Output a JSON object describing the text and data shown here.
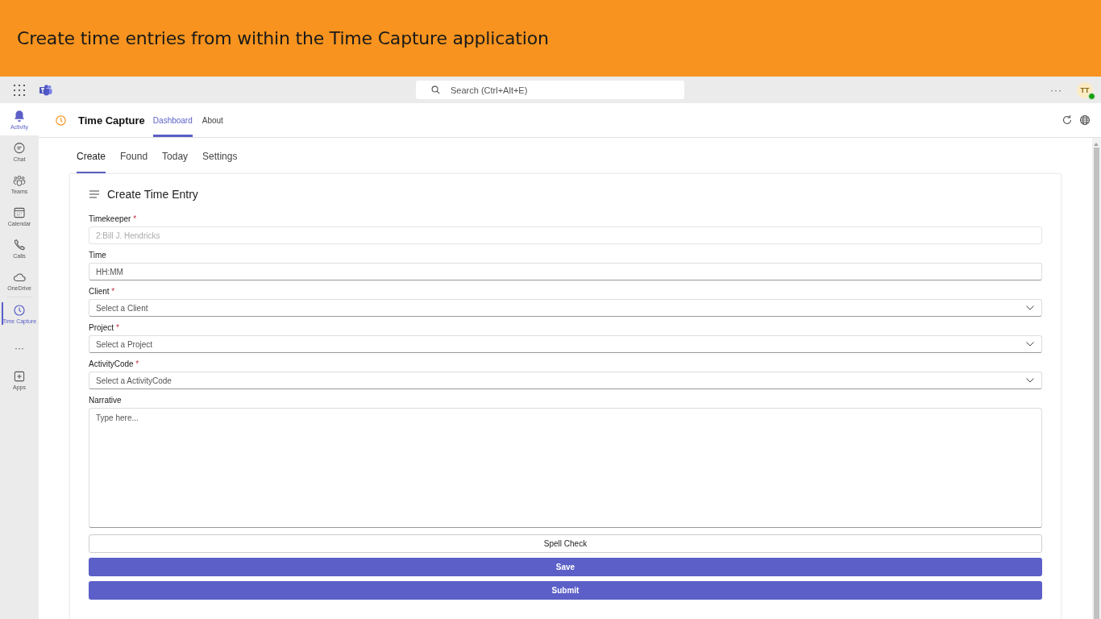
{
  "banner": {
    "title": "Create time entries from within the Time Capture application"
  },
  "top_bar": {
    "search": {
      "placeholder": "Search (Ctrl+Alt+E)"
    },
    "more": "···",
    "avatar": {
      "initials": "TT"
    }
  },
  "rail": {
    "items": [
      {
        "label": "Activity",
        "selected": false,
        "hovered": true
      },
      {
        "label": "Chat",
        "selected": false,
        "hovered": false
      },
      {
        "label": "Teams",
        "selected": false,
        "hovered": false
      },
      {
        "label": "Calendar",
        "selected": false,
        "hovered": false
      },
      {
        "label": "Calls",
        "selected": false,
        "hovered": false
      },
      {
        "label": "OneDrive",
        "selected": false,
        "hovered": false
      },
      {
        "label": "Time Capture",
        "selected": true,
        "hovered": false
      }
    ],
    "more": "···",
    "apps": {
      "label": "Apps"
    }
  },
  "app_header": {
    "title": "Time Capture",
    "tabs": [
      {
        "label": "Dashboard",
        "selected": true
      },
      {
        "label": "About",
        "selected": false
      }
    ]
  },
  "subtabs": [
    {
      "label": "Create",
      "selected": true
    },
    {
      "label": "Found",
      "selected": false
    },
    {
      "label": "Today",
      "selected": false
    },
    {
      "label": "Settings",
      "selected": false
    }
  ],
  "form": {
    "title": "Create Time Entry",
    "fields": [
      {
        "label": "Timekeeper",
        "required_mark": "*",
        "kind": "text",
        "disabled": true,
        "placeholder": "2:Bill J. Hendricks"
      },
      {
        "label": "Time",
        "kind": "text",
        "disabled": false,
        "placeholder": "HH:MM"
      },
      {
        "label": "Client",
        "required_mark": "*",
        "kind": "select",
        "disabled": false,
        "placeholder": "Select a Client"
      },
      {
        "label": "Project",
        "required_mark": "*",
        "kind": "select",
        "disabled": false,
        "placeholder": "Select a Project"
      },
      {
        "label": "ActivityCode",
        "required_mark": "*",
        "kind": "select",
        "disabled": false,
        "placeholder": "Select a ActivityCode"
      },
      {
        "label": "Narrative",
        "kind": "textarea",
        "disabled": false,
        "placeholder": "Type here..."
      }
    ],
    "buttons": [
      {
        "label": "Spell Check",
        "kind": "secondary"
      },
      {
        "label": "Save",
        "kind": "primary"
      },
      {
        "label": "Submit",
        "kind": "primary"
      }
    ]
  }
}
